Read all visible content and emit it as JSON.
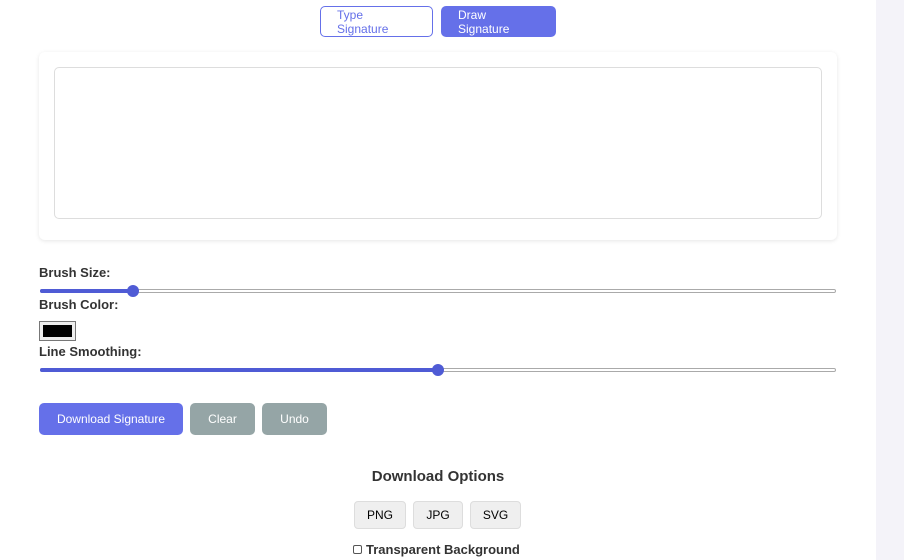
{
  "tabs": {
    "type": "Type Signature",
    "draw": "Draw Signature"
  },
  "controls": {
    "brush_size_label": "Brush Size:",
    "brush_size_fraction": 0.116,
    "brush_color_label": "Brush Color:",
    "brush_color": "#000000",
    "smoothing_label": "Line Smoothing:",
    "smoothing_fraction": 0.5
  },
  "buttons": {
    "download": "Download Signature",
    "clear": "Clear",
    "undo": "Undo"
  },
  "download_options": {
    "title": "Download Options",
    "formats": [
      "PNG",
      "JPG",
      "SVG"
    ],
    "transparent_label": "Transparent Background",
    "transparent_checked": false
  },
  "colors": {
    "accent": "#6570e9",
    "secondary": "#95a5a6"
  }
}
